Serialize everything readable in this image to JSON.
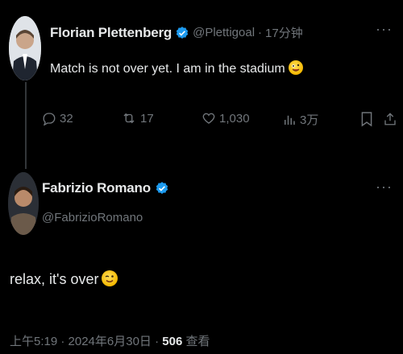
{
  "tweet1": {
    "display_name": "Florian Plettenberg",
    "handle": "@Plettigoal",
    "separator": "·",
    "time_ago": "17分钟",
    "text": "Match is not over yet. I am in the stadium",
    "emoji": "zany-face",
    "actions": {
      "replies": "32",
      "reposts": "17",
      "likes": "1,030",
      "views": "3万"
    }
  },
  "tweet2": {
    "display_name": "Fabrizio Romano",
    "handle": "@FabrizioRomano",
    "text": "relax, it's over",
    "emoji": "winking-face",
    "meta": {
      "timestamp": "上午5:19 · 2024年6月30日 ·",
      "views_count": "506",
      "views_label": "查看"
    }
  },
  "colors": {
    "background": "#000000",
    "primary_text": "#e7e9ea",
    "secondary_text": "#71767b",
    "verified": "#1d9bf0",
    "thread_line": "#333639"
  },
  "more_icon": "more-horizontal-icon"
}
